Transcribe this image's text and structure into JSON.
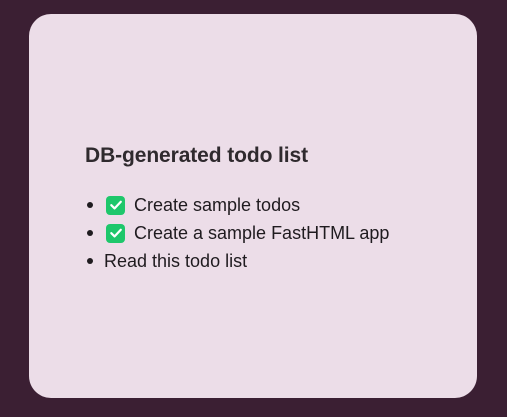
{
  "card": {
    "title": "DB-generated todo list"
  },
  "todos": [
    {
      "label": "Create sample todos",
      "done": true,
      "icon": "check-icon"
    },
    {
      "label": "Create a sample FastHTML app",
      "done": true,
      "icon": "check-icon"
    },
    {
      "label": "Read this todo list",
      "done": false
    }
  ],
  "colors": {
    "background": "#3b1f33",
    "card": "#ecdde8",
    "check": "#1ec76b",
    "text": "#1f1b1f"
  }
}
